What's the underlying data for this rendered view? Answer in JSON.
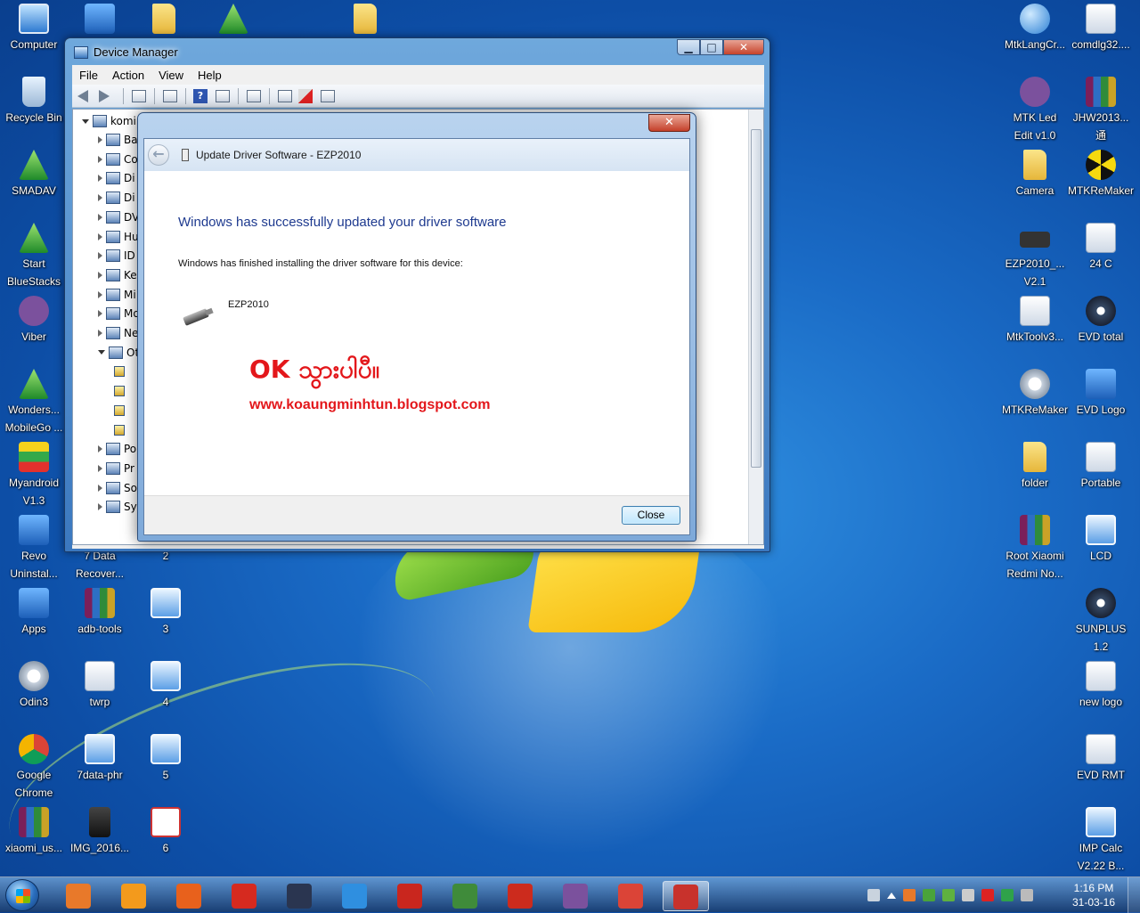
{
  "desktop": {
    "left_col1": [
      {
        "label": "Computer",
        "icon": "computer-icon",
        "kind": "computer"
      },
      {
        "label": "Recycle Bin",
        "icon": "recycle-bin-icon",
        "kind": "recycle"
      },
      {
        "label": "SMADAV",
        "icon": "smadav-icon",
        "kind": "green"
      },
      {
        "label": "Start\nBlueStacks",
        "icon": "bluestacks-icon",
        "kind": "green"
      },
      {
        "label": "Viber",
        "icon": "viber-icon",
        "kind": "viber"
      },
      {
        "label": "Wonders...\nMobileGo ...",
        "icon": "mobilego-icon",
        "kind": "green"
      },
      {
        "label": "Myandroid\nV1.3",
        "icon": "myandroid-icon",
        "kind": "flag"
      },
      {
        "label": "Revo\nUninstal...",
        "icon": "revo-uninstaller-icon",
        "kind": "blue"
      },
      {
        "label": "Apps",
        "icon": "apps-icon",
        "kind": "blue"
      },
      {
        "label": "Odin3",
        "icon": "odin-icon",
        "kind": "gear"
      },
      {
        "label": "Google\nChrome",
        "icon": "chrome-icon",
        "kind": "chrome"
      },
      {
        "label": "xiaomi_us...",
        "icon": "rar-archive-icon",
        "kind": "rar"
      }
    ],
    "left_col2": [
      {
        "label": "7 Data\nRecover...",
        "icon": "data-recovery-icon",
        "kind": "shortcut"
      },
      {
        "label": "adb-tools",
        "icon": "rar-archive-icon",
        "kind": "rar"
      },
      {
        "label": "twrp",
        "icon": "twrp-file-icon",
        "kind": "shortcut"
      },
      {
        "label": "7data-phr",
        "icon": "7data-phone-icon",
        "kind": "screen"
      },
      {
        "label": "IMG_2016...",
        "icon": "image-file-icon",
        "kind": "img"
      }
    ],
    "left_col3": [
      {
        "label": "2",
        "icon": "screenshot-file-icon",
        "kind": "screen"
      },
      {
        "label": "3",
        "icon": "screenshot-file-icon",
        "kind": "screen"
      },
      {
        "label": "4",
        "icon": "screenshot-file-icon",
        "kind": "screen"
      },
      {
        "label": "5",
        "icon": "screenshot-file-icon",
        "kind": "screen"
      },
      {
        "label": "6",
        "icon": "screenshot-file-icon",
        "kind": "film"
      }
    ],
    "top_hidden": [
      {
        "label": "",
        "icon": "shortcut-app-icon",
        "kind": "blue"
      },
      {
        "label": "",
        "icon": "folder-icon",
        "kind": "folder"
      },
      {
        "label": "",
        "icon": "root-master-icon",
        "kind": "green"
      },
      {
        "label": "",
        "icon": "folder-icon",
        "kind": "folder"
      }
    ],
    "right_col1": [
      {
        "label": "MtkLangCr...",
        "icon": "globe-icon",
        "kind": "globe"
      },
      {
        "label": "MTK Led\nEdit v1.0",
        "icon": "mtk-led-edit-icon",
        "kind": "viber"
      },
      {
        "label": "Camera",
        "icon": "folder-icon",
        "kind": "folder"
      },
      {
        "label": "EZP2010_...\nV2.1",
        "icon": "chip-icon",
        "kind": "chip"
      },
      {
        "label": "MtkToolv3...",
        "icon": "mtk-tool-icon",
        "kind": "shortcut"
      },
      {
        "label": "MTKReMaker",
        "icon": "gear-icon",
        "kind": "gear"
      },
      {
        "label": "folder",
        "icon": "folder-icon",
        "kind": "folder"
      },
      {
        "label": "Root Xiaomi\nRedmi No...",
        "icon": "rar-archive-icon",
        "kind": "rar"
      }
    ],
    "right_col2": [
      {
        "label": "comdlg32....",
        "icon": "system-file-icon",
        "kind": "shortcut"
      },
      {
        "label": "JHW2013...\n通",
        "icon": "rar-archive-icon",
        "kind": "rar"
      },
      {
        "label": "MTKReMaker",
        "icon": "radiation-icon",
        "kind": "nuke"
      },
      {
        "label": "24 C",
        "icon": "shortcut-app-icon",
        "kind": "shortcut"
      },
      {
        "label": "EVD  total",
        "icon": "evd-total-icon",
        "kind": "disc"
      },
      {
        "label": "EVD Logo",
        "icon": "evd-logo-icon",
        "kind": "blue"
      },
      {
        "label": "Portable",
        "icon": "portable-icon",
        "kind": "shortcut"
      },
      {
        "label": "LCD",
        "icon": "lcd-icon",
        "kind": "screen"
      },
      {
        "label": "SUNPLUS\n1.2",
        "icon": "sunplus-icon",
        "kind": "disc"
      },
      {
        "label": "new logo",
        "icon": "new-logo-icon",
        "kind": "shortcut"
      },
      {
        "label": "EVD RMT",
        "icon": "evd-rmt-icon",
        "kind": "shortcut"
      },
      {
        "label": "IMP Calc\nV2.22 B...",
        "icon": "imp-calc-icon",
        "kind": "screen"
      }
    ]
  },
  "device_manager": {
    "title": "Device Manager",
    "caption": {
      "minimize": "▁",
      "maximize": "□",
      "close": "✕"
    },
    "menu": [
      "File",
      "Action",
      "View",
      "Help"
    ],
    "tree_root": "komin",
    "tree_rows": [
      {
        "label": "Ba",
        "open": false,
        "warn": false
      },
      {
        "label": "Co",
        "open": false,
        "warn": false
      },
      {
        "label": "Di",
        "open": false,
        "warn": false
      },
      {
        "label": "Di",
        "open": false,
        "warn": false
      },
      {
        "label": "DV",
        "open": false,
        "warn": false
      },
      {
        "label": "Hu",
        "open": false,
        "warn": false
      },
      {
        "label": "ID",
        "open": false,
        "warn": false
      },
      {
        "label": "Ke",
        "open": false,
        "warn": false
      },
      {
        "label": "Mi",
        "open": false,
        "warn": false
      },
      {
        "label": "Mo",
        "open": false,
        "warn": false
      },
      {
        "label": "Ne",
        "open": false,
        "warn": false
      },
      {
        "label": "Ot",
        "open": true,
        "warn": false
      },
      {
        "label": "",
        "open": false,
        "warn": true
      },
      {
        "label": "",
        "open": false,
        "warn": true
      },
      {
        "label": "",
        "open": false,
        "warn": true
      },
      {
        "label": "",
        "open": false,
        "warn": true
      },
      {
        "label": "Po",
        "open": false,
        "warn": false
      },
      {
        "label": "Pr",
        "open": false,
        "warn": false
      },
      {
        "label": "So",
        "open": false,
        "warn": false
      },
      {
        "label": "Sy",
        "open": false,
        "warn": false
      }
    ]
  },
  "dialog": {
    "title": "Update Driver Software - EZP2010",
    "close_glyph": "✕",
    "back_glyph": "←",
    "heading": "Windows has successfully updated your driver software",
    "subtext": "Windows has finished installing the driver software for this device:",
    "device_name": "EZP2010",
    "overlay_text": "OK သွားပါပီ။",
    "overlay_url": "www.koaungminhtun.blogspot.com",
    "close_button": "Close"
  },
  "taskbar": {
    "apps": [
      {
        "name": "media-player-icon",
        "color": "#e8792a"
      },
      {
        "name": "ball-app-icon",
        "color": "#f39a1c"
      },
      {
        "name": "firefox-icon",
        "color": "#e8611c"
      },
      {
        "name": "registry-app-icon",
        "color": "#d62a1f"
      },
      {
        "name": "disc-app-icon",
        "color": "#2a3550"
      },
      {
        "name": "internet-explorer-icon",
        "color": "#2f8fe0"
      },
      {
        "name": "bios-app-icon",
        "color": "#c9261e"
      },
      {
        "name": "au-tool-icon",
        "color": "#3f8b3a"
      },
      {
        "name": "zoran-divx-icon",
        "color": "#cc2b1d"
      },
      {
        "name": "viber-taskbar-icon",
        "color": "#7b519d"
      },
      {
        "name": "chrome-taskbar-icon",
        "color": "#db4437"
      },
      {
        "name": "toolbox-icon",
        "color": "#c8322c"
      }
    ],
    "clock_time": "1:16 PM",
    "clock_date": "31-03-16"
  },
  "colors": {
    "overlay_red": "#e3171b",
    "heading_blue": "#1e3a8f"
  }
}
